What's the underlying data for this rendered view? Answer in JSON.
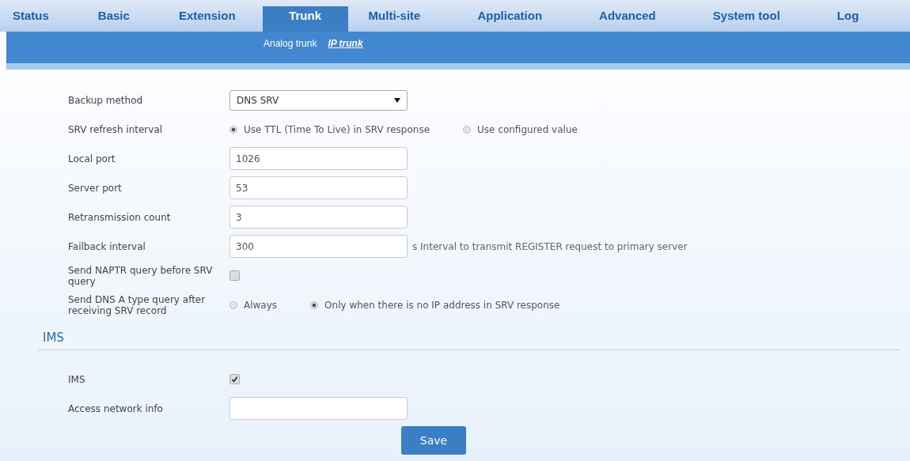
{
  "nav_tabs": [
    {
      "label": "Status",
      "selected": false
    },
    {
      "label": "Basic",
      "selected": false
    },
    {
      "label": "Extension",
      "selected": false
    },
    {
      "label": "Trunk",
      "selected": true
    },
    {
      "label": "Multi-site",
      "selected": false
    },
    {
      "label": "Application",
      "selected": false
    },
    {
      "label": "Advanced",
      "selected": false
    },
    {
      "label": "System tool",
      "selected": false
    },
    {
      "label": "Log",
      "selected": false
    }
  ],
  "sub_tabs": [
    {
      "label": "Analog trunk",
      "selected": false
    },
    {
      "label": "IP trunk",
      "selected": true
    }
  ],
  "rows": [
    {
      "kind": "select",
      "label": "Backup method",
      "value": "DNS SRV"
    },
    {
      "kind": "radio",
      "label": "SRV refresh interval",
      "options": [
        {
          "label": "Use TTL (Time To Live) in SRV response",
          "selected": true
        },
        {
          "label": "Use configured value",
          "selected": false
        }
      ]
    },
    {
      "kind": "text",
      "label": "Local port",
      "value": "1026"
    },
    {
      "kind": "text",
      "label": "Server port",
      "value": "53"
    },
    {
      "kind": "text",
      "label": "Retransmission count",
      "value": "3"
    },
    {
      "kind": "text",
      "label": "Failback interval",
      "value": "300",
      "note": "s Interval to transmit REGISTER request to primary server"
    },
    {
      "kind": "checkbox",
      "label": "Send NAPTR query before SRV query",
      "checked": false
    },
    {
      "kind": "radio",
      "label": "Send DNS A type query after receiving SRV record",
      "options": [
        {
          "label": "Always",
          "selected": false
        },
        {
          "label": "Only when there is no IP address in SRV response",
          "selected": true
        }
      ]
    }
  ],
  "ims_section": {
    "title": "IMS",
    "rows": [
      {
        "kind": "checkbox",
        "label": "IMS",
        "checked": true
      },
      {
        "kind": "text",
        "label": "Access network info",
        "value": ""
      }
    ]
  },
  "save_button": "Save"
}
